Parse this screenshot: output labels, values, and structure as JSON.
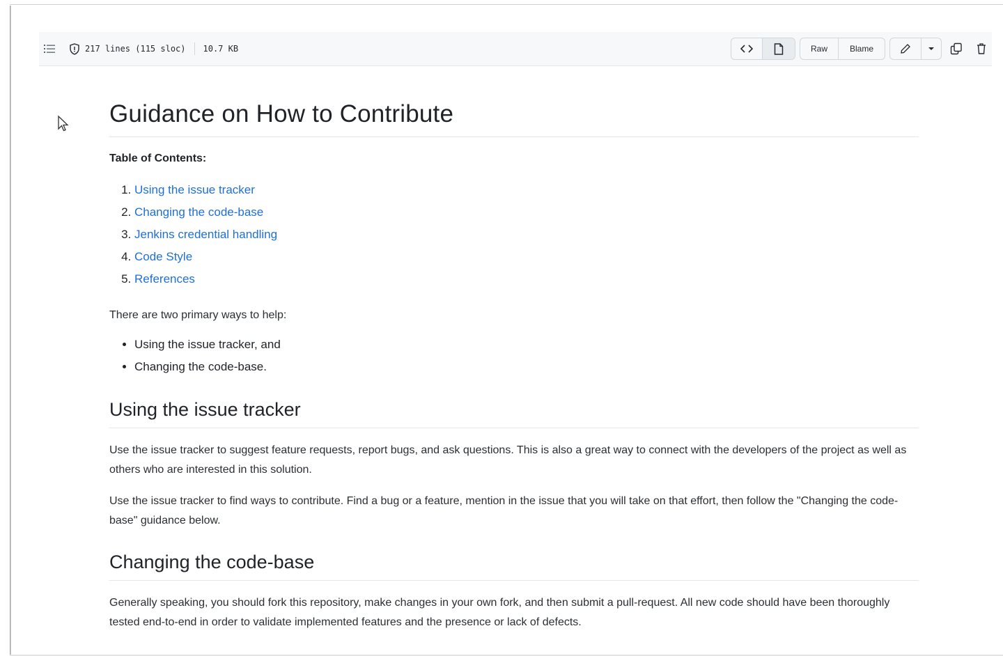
{
  "file_header": {
    "lines_info": "217 lines (115 sloc)",
    "file_size": "10.7 KB",
    "raw_label": "Raw",
    "blame_label": "Blame"
  },
  "document": {
    "title": "Guidance on How to Contribute",
    "toc_heading": "Table of Contents:",
    "toc_items": [
      "Using the issue tracker",
      "Changing the code-base",
      "Jenkins credential handling",
      "Code Style",
      "References"
    ],
    "intro": "There are two primary ways to help:",
    "ways": [
      "Using the issue tracker, and",
      "Changing the code-base."
    ],
    "section1": {
      "heading": "Using the issue tracker",
      "para1": "Use the issue tracker to suggest feature requests, report bugs, and ask questions. This is also a great way to connect with the developers of the project as well as others who are interested in this solution.",
      "para2": "Use the issue tracker to find ways to contribute. Find a bug or a feature, mention in the issue that you will take on that effort, then follow the \"Changing the code-base\" guidance below."
    },
    "section2": {
      "heading": "Changing the code-base",
      "para1": "Generally speaking, you should fork this repository, make changes in your own fork, and then submit a pull-request. All new code should have been thoroughly tested end-to-end in order to validate implemented features and the presence or lack of defects."
    }
  },
  "colors": {
    "link": "#1f6fd6",
    "header_bg": "#f6f8fa",
    "border": "#d0d7de"
  },
  "icons": [
    "list-toc-icon",
    "shield-info-icon",
    "code-icon",
    "file-icon",
    "pencil-icon",
    "caret-down-icon",
    "copy-icon",
    "trash-icon",
    "mouse-cursor-icon"
  ]
}
